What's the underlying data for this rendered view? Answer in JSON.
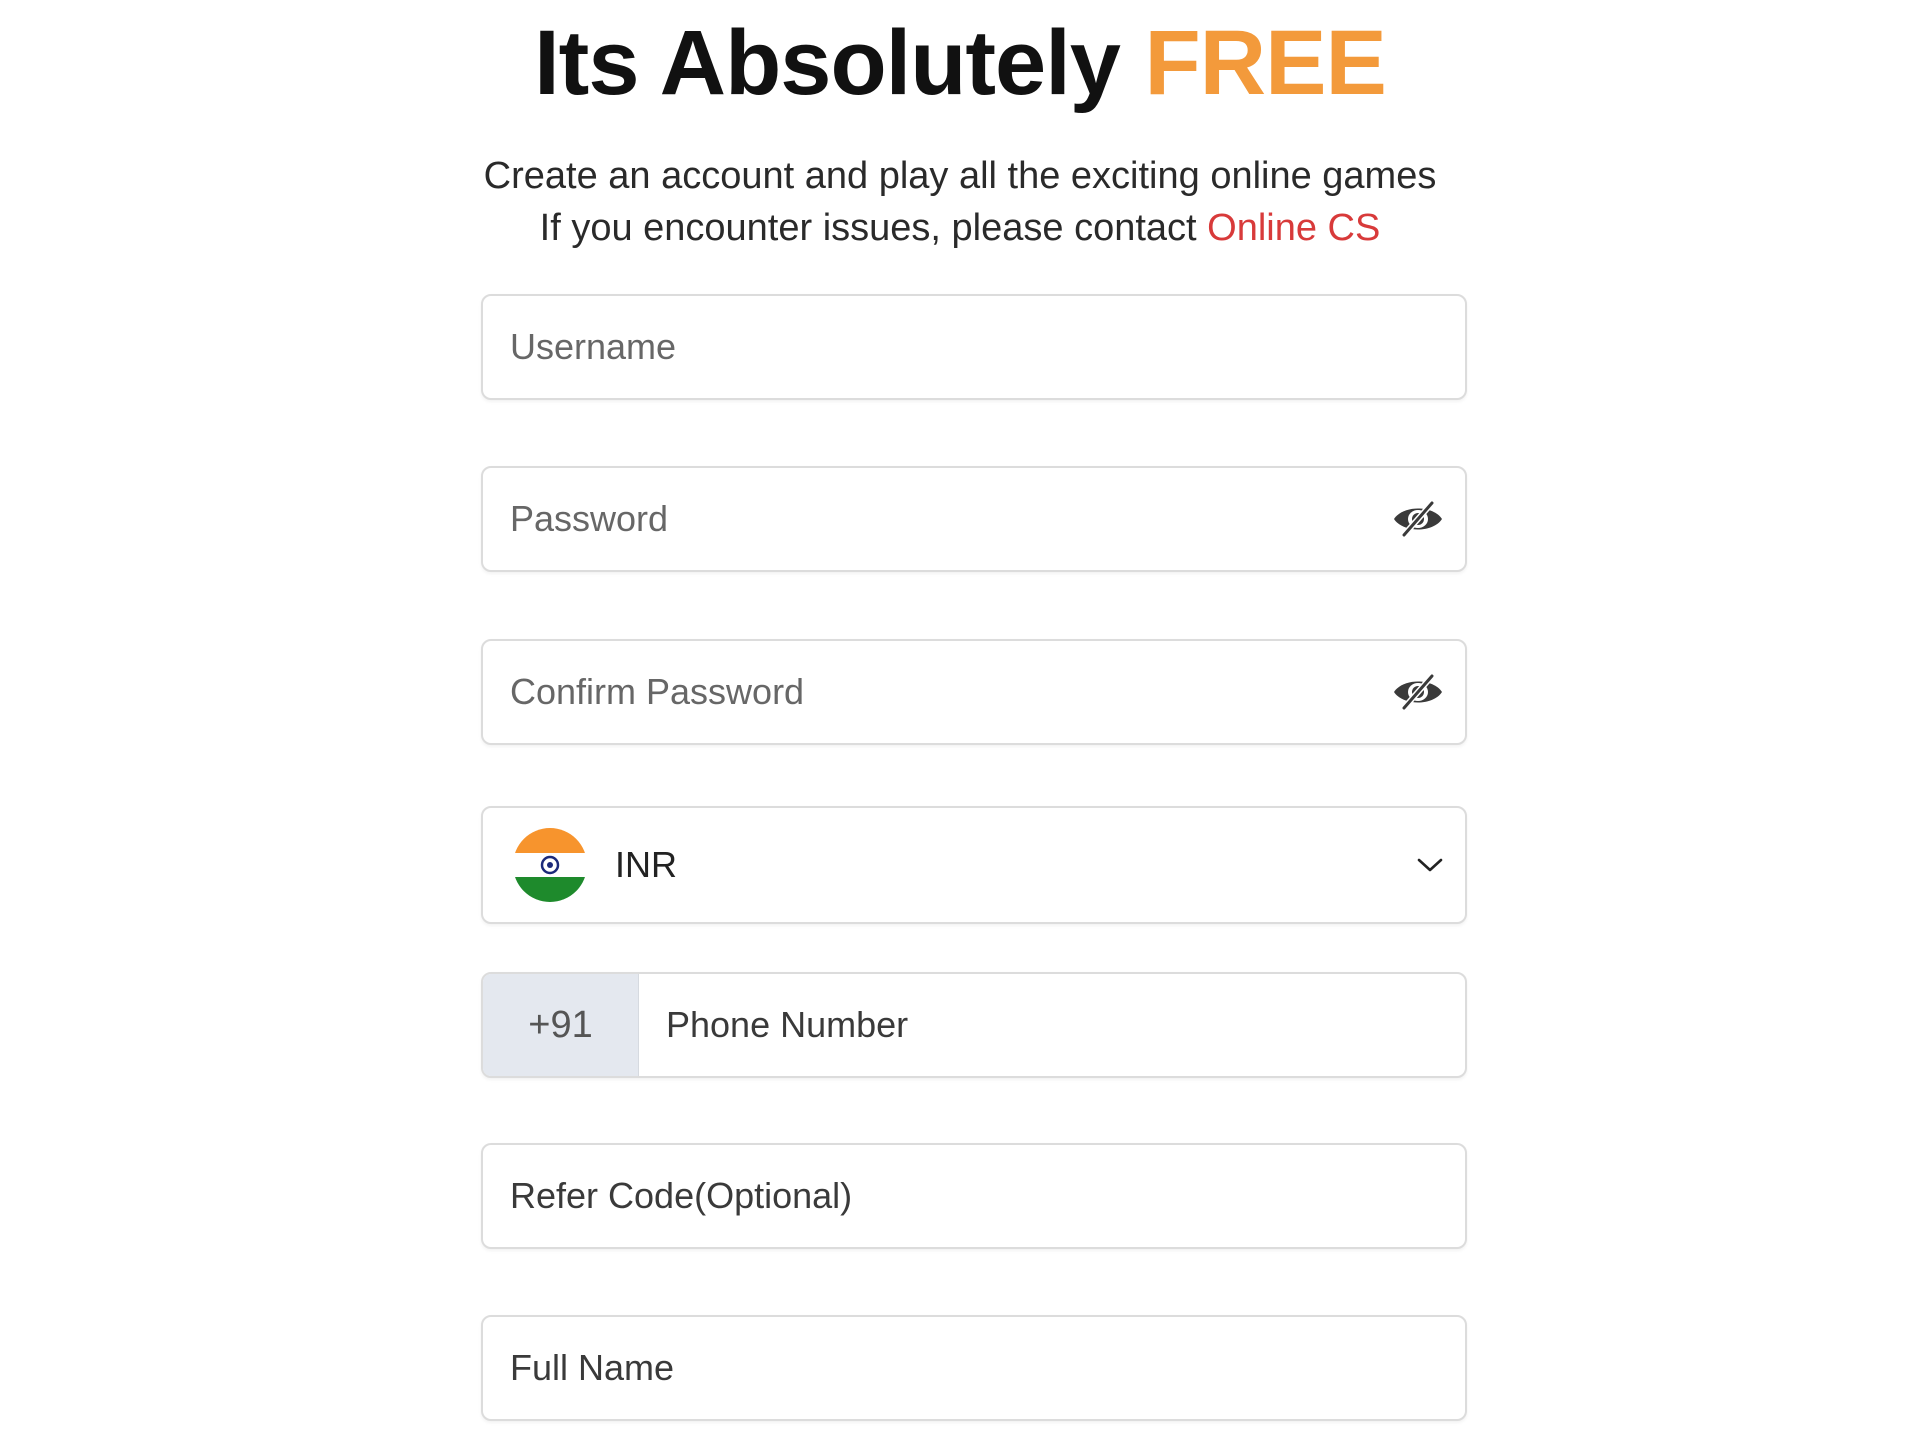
{
  "header": {
    "title_main": "Its Absolutely",
    "title_accent": "FREE",
    "subtitle_line1": "Create an account and play all the exciting online games",
    "subtitle_line2_prefix": "If you encounter issues, please contact",
    "support_link": "Online CS"
  },
  "colors": {
    "accent_orange": "#f39a3b",
    "link_red": "#d83a3a",
    "prefix_bg": "#e4e8ef"
  },
  "form": {
    "username": {
      "placeholder": "Username",
      "value": ""
    },
    "password": {
      "placeholder": "Password",
      "value": "",
      "toggle_icon": "eye-slash-icon"
    },
    "confirm_password": {
      "placeholder": "Confirm Password",
      "value": "",
      "toggle_icon": "eye-slash-icon"
    },
    "currency": {
      "selected": "INR",
      "flag_icon": "india-flag-icon",
      "dropdown_icon": "chevron-down-icon"
    },
    "phone": {
      "prefix": "+91",
      "placeholder": "Phone Number",
      "value": ""
    },
    "refer_code": {
      "placeholder": "Refer Code(Optional)",
      "value": ""
    },
    "full_name": {
      "placeholder": "Full Name",
      "value": ""
    }
  }
}
